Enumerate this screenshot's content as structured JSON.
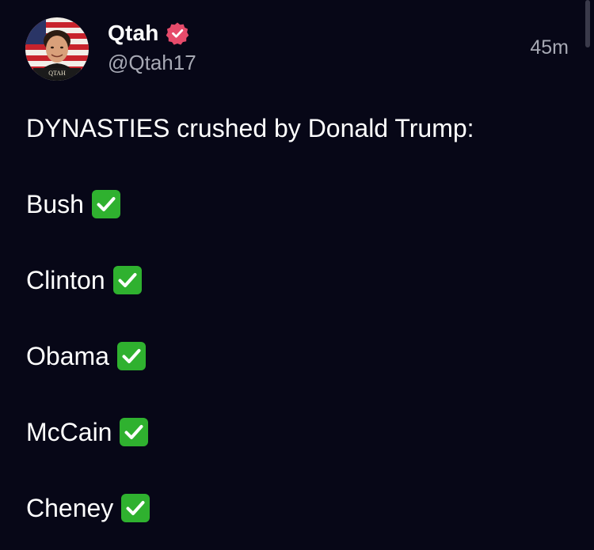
{
  "author": {
    "display_name": "Qtah",
    "handle": "@Qtah17",
    "verified_icon": "verified-badge-icon",
    "verified_color": "#e64b6b"
  },
  "timestamp": "45m",
  "post": {
    "intro": "DYNASTIES crushed by Donald Trump:",
    "dynasties": [
      {
        "name": "Bush",
        "mark": "check-mark-icon"
      },
      {
        "name": "Clinton",
        "mark": "check-mark-icon"
      },
      {
        "name": "Obama",
        "mark": "check-mark-icon"
      },
      {
        "name": "McCain",
        "mark": "check-mark-icon"
      },
      {
        "name": "Cheney",
        "mark": "check-mark-icon"
      }
    ]
  },
  "colors": {
    "background": "#070717",
    "text_primary": "#ffffff",
    "text_secondary": "#a7a9b4",
    "check_green": "#2fb12f"
  }
}
